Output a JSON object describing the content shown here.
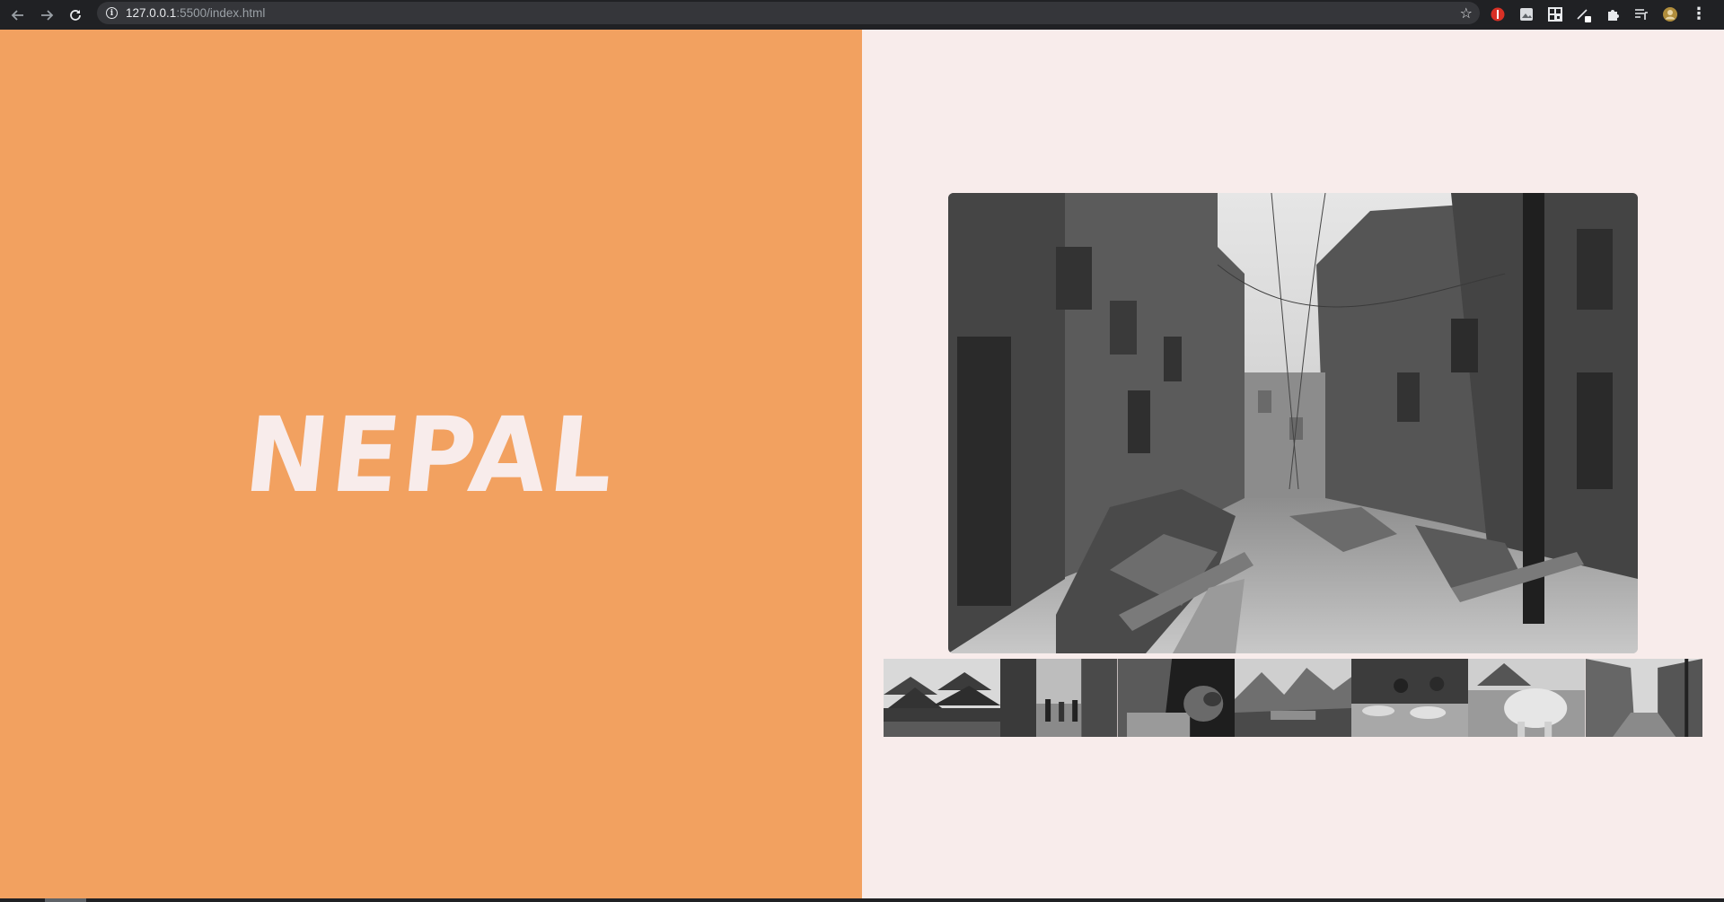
{
  "browser": {
    "url_host": "127.0.0.1",
    "url_rest": ":5500/index.html",
    "icons": {
      "back": "back-arrow-icon",
      "forward": "forward-arrow-icon",
      "reload": "reload-icon",
      "info": "site-info-icon",
      "bookmark": "star-icon",
      "menu": "kebab-menu-icon"
    },
    "extensions": [
      "red-extension-icon",
      "image-extension-icon",
      "qr-code-icon",
      "pen-extension-icon",
      "puzzle-extensions-icon",
      "reading-list-icon",
      "profile-avatar-icon"
    ]
  },
  "page": {
    "title": "NEPAL",
    "colors": {
      "left_bg": "#f2a160",
      "right_bg": "#f8eceb",
      "title": "#f8eceb"
    },
    "thumbnail_count": 7
  }
}
